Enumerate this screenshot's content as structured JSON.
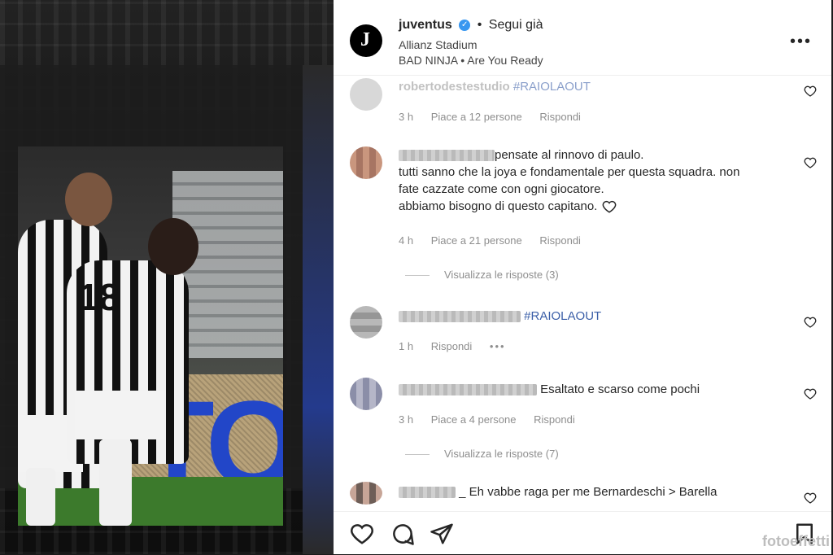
{
  "post": {
    "username": "juventus",
    "follow_label": "Segui già",
    "location": "Allianz Stadium",
    "audio": "BAD NINJA • Are You Ready",
    "more_icon": "more-horizontal-icon"
  },
  "media": {
    "board_text": "TO",
    "jersey_number": "18"
  },
  "comments": [
    {
      "username": "robertodestestudio",
      "text": "#RAIOLAOUT",
      "time": "3 h",
      "likes": "Piace a 12 persone",
      "reply": "Rispondi"
    },
    {
      "text_lines": [
        "pensate al rinnovo di paulo.",
        "tutti sanno che la joya e fondamentale per questa squadra. non",
        "fate cazzate come con ogni giocatore.",
        "abbiamo bisogno di questo capitano."
      ],
      "time": "4 h",
      "likes": "Piace a 21 persone",
      "reply": "Rispondi",
      "view_replies": "Visualizza le risposte (3)"
    },
    {
      "text": "#RAIOLAOUT",
      "time": "1 h",
      "reply": "Rispondi",
      "options": "•••"
    },
    {
      "text": "Esaltato e scarso come pochi",
      "time": "3 h",
      "likes": "Piace a 4 persone",
      "reply": "Rispondi",
      "view_replies": "Visualizza le risposte (7)"
    },
    {
      "text": "_ Eh vabbe raga per me Bernardeschi > Barella"
    }
  ],
  "watermark": "fotoeffetti",
  "colors": {
    "hashtag": "#3b5fa8",
    "verified": "#3897f0",
    "meta": "#8e8e8e"
  }
}
